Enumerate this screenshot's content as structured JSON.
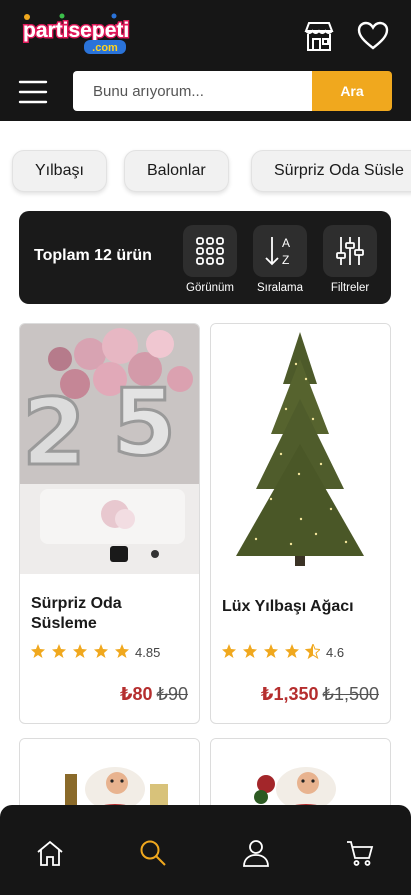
{
  "header": {
    "logo_text": "partisepeti",
    "logo_sub": ".com",
    "store_icon": "store-icon",
    "favorites_icon": "heart-icon",
    "menu_icon": "hamburger-icon"
  },
  "search": {
    "placeholder": "Bunu arıyorum...",
    "button_label": "Ara"
  },
  "categories": [
    "Yılbaşı",
    "Balonlar",
    "Sürpriz Oda Süsle"
  ],
  "toolbar": {
    "total_label": "Toplam 12 ürün",
    "view_label": "Görünüm",
    "sort_label": "Sıralama",
    "filter_label": "Filtreler"
  },
  "products": [
    {
      "name_line1": "Sürpriz Oda",
      "name_line2": "Süsleme",
      "rating": 4.85,
      "rating_text": "4.85",
      "price": "₺80",
      "old_price": "₺90",
      "image": "balloons-25-image"
    },
    {
      "name_line1": "Lüx Yılbaşı Ağacı",
      "name_line2": "",
      "rating": 4.6,
      "rating_text": "4.6",
      "price": "₺1,350",
      "old_price": "₺1,500",
      "image": "christmas-tree-image"
    },
    {
      "image": "santa-figurine-image"
    },
    {
      "image": "santa-figurine-image"
    }
  ],
  "bottom_nav": [
    "home-icon",
    "search-icon",
    "user-icon",
    "cart-icon"
  ],
  "colors": {
    "header_bg": "#161616",
    "accent": "#f0a81e",
    "price_red": "#b52e2e",
    "star": "#f0a81e"
  }
}
